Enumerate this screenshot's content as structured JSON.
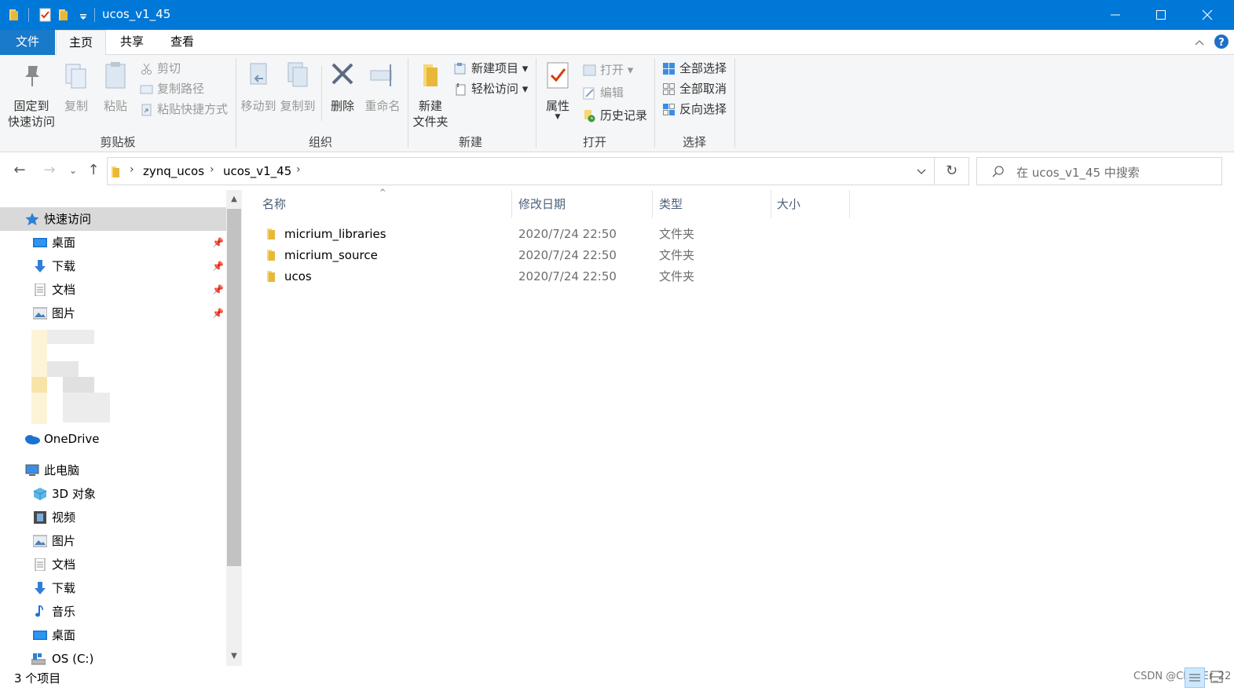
{
  "window": {
    "title": "ucos_v1_45"
  },
  "tabs": {
    "file": "文件",
    "home": "主页",
    "share": "共享",
    "view": "查看"
  },
  "ribbon": {
    "clipboard": {
      "label": "剪贴板",
      "pin": "固定到",
      "pin2": "快速访问",
      "copy": "复制",
      "paste": "粘贴",
      "cut": "剪切",
      "copy_path": "复制路径",
      "paste_shortcut": "粘贴快捷方式"
    },
    "organize": {
      "label": "组织",
      "move_to": "移动到",
      "copy_to": "复制到",
      "delete": "删除",
      "rename": "重命名"
    },
    "new": {
      "label": "新建",
      "new_folder": "新建",
      "new_folder2": "文件夹",
      "new_item": "新建项目",
      "easy_access": "轻松访问"
    },
    "open": {
      "label": "打开",
      "properties": "属性",
      "open": "打开",
      "edit": "编辑",
      "history": "历史记录"
    },
    "select": {
      "label": "选择",
      "select_all": "全部选择",
      "select_none": "全部取消",
      "invert": "反向选择"
    }
  },
  "address": {
    "crumbs": [
      "zynq_ucos",
      "ucos_v1_45"
    ],
    "search_placeholder": "在 ucos_v1_45 中搜索"
  },
  "nav": {
    "quick_access": "快速访问",
    "desktop": "桌面",
    "downloads": "下载",
    "documents": "文档",
    "pictures": "图片",
    "onedrive": "OneDrive",
    "this_pc": "此电脑",
    "objects3d": "3D 对象",
    "videos": "视频",
    "pictures2": "图片",
    "documents2": "文档",
    "downloads2": "下载",
    "music": "音乐",
    "desktop2": "桌面",
    "osdrive": "OS (C:)"
  },
  "columns": {
    "name": "名称",
    "date": "修改日期",
    "type": "类型",
    "size": "大小"
  },
  "files": [
    {
      "name": "micrium_libraries",
      "date": "2020/7/24 22:50",
      "type": "文件夹"
    },
    {
      "name": "micrium_source",
      "date": "2020/7/24 22:50",
      "type": "文件夹"
    },
    {
      "name": "ucos",
      "date": "2020/7/24 22:50",
      "type": "文件夹"
    }
  ],
  "status": {
    "count": "3 个项目",
    "watermark": "CSDN @ChenEr_22"
  },
  "colors": {
    "titlebar": "#0078d7",
    "file_tab": "#1979ca",
    "folder": "#f8c84a",
    "selected": "#d9d9d9"
  }
}
